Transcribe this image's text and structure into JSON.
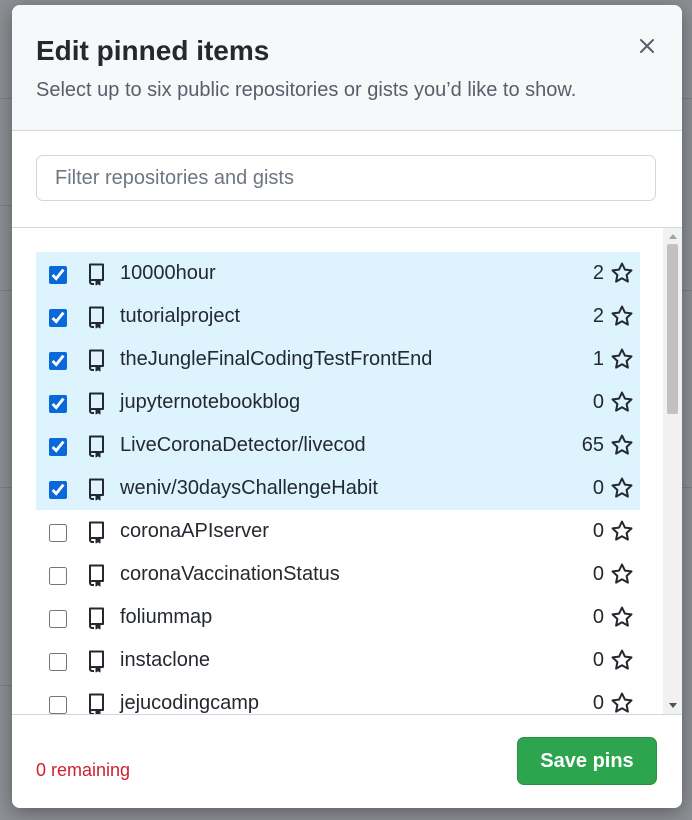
{
  "dialog": {
    "title": "Edit pinned items",
    "subtitle": "Select up to six public repositories or gists you’d like to show.",
    "filter_placeholder": "Filter repositories and gists",
    "remaining_text": "0 remaining",
    "save_label": "Save pins"
  },
  "repos": [
    {
      "name": "10000hour",
      "stars": "2",
      "checked": true
    },
    {
      "name": "tutorialproject",
      "stars": "2",
      "checked": true
    },
    {
      "name": "theJungleFinalCodingTestFrontEnd",
      "stars": "1",
      "checked": true
    },
    {
      "name": "jupyternotebookblog",
      "stars": "0",
      "checked": true
    },
    {
      "name": "LiveCoronaDetector/livecod",
      "stars": "65",
      "checked": true
    },
    {
      "name": "weniv/30daysChallengeHabit",
      "stars": "0",
      "checked": true
    },
    {
      "name": "coronaAPIserver",
      "stars": "0",
      "checked": false
    },
    {
      "name": "coronaVaccinationStatus",
      "stars": "0",
      "checked": false
    },
    {
      "name": "foliummap",
      "stars": "0",
      "checked": false
    },
    {
      "name": "instaclone",
      "stars": "0",
      "checked": false
    },
    {
      "name": "jejucodingcamp",
      "stars": "0",
      "checked": false
    }
  ],
  "colors": {
    "selected_bg": "#ddf4ff",
    "save_button": "#2da44e",
    "remaining_text": "#cf222e",
    "checkbox_accent": "#0969da"
  },
  "icons": {
    "close": "x-icon",
    "repo": "repo-icon",
    "star": "star-outline-icon"
  }
}
